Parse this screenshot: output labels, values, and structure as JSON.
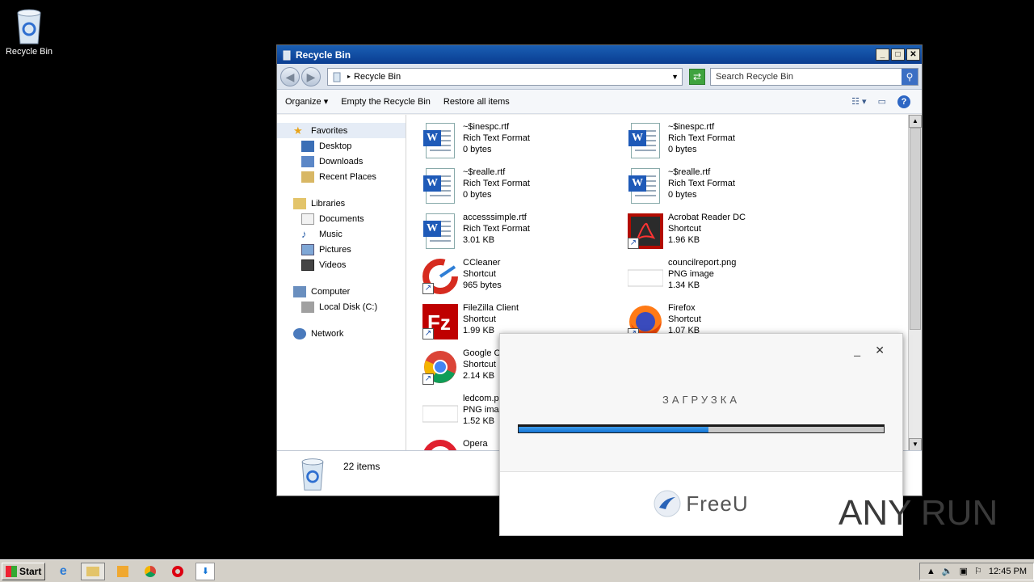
{
  "desktop": {
    "recycle_bin_label": "Recycle Bin"
  },
  "window": {
    "title": "Recycle Bin",
    "controls": {
      "minimize": "_",
      "maximize": "□",
      "close": "✕"
    },
    "address": {
      "breadcrumb": "Recycle Bin"
    },
    "search": {
      "placeholder": "Search Recycle Bin"
    },
    "toolbar": {
      "organize": "Organize",
      "empty": "Empty the Recycle Bin",
      "restore": "Restore all items"
    },
    "nav": {
      "favorites": {
        "label": "Favorites",
        "items": [
          "Desktop",
          "Downloads",
          "Recent Places"
        ]
      },
      "libraries": {
        "label": "Libraries",
        "items": [
          "Documents",
          "Music",
          "Pictures",
          "Videos"
        ]
      },
      "computer": {
        "label": "Computer",
        "items": [
          "Local Disk (C:)"
        ]
      },
      "network": {
        "label": "Network"
      }
    },
    "files": [
      {
        "name": "~$inespc.rtf",
        "type": "Rich Text Format",
        "size": "0 bytes",
        "icon": "word-icon"
      },
      {
        "name": "~$inespc.rtf",
        "type": "Rich Text Format",
        "size": "0 bytes",
        "icon": "word-icon"
      },
      {
        "name": "~$realle.rtf",
        "type": "Rich Text Format",
        "size": "0 bytes",
        "icon": "word-icon"
      },
      {
        "name": "~$realle.rtf",
        "type": "Rich Text Format",
        "size": "0 bytes",
        "icon": "word-icon"
      },
      {
        "name": "accesssimple.rtf",
        "type": "Rich Text Format",
        "size": "3.01 KB",
        "icon": "word-icon"
      },
      {
        "name": "Acrobat Reader DC",
        "type": "Shortcut",
        "size": "1.96 KB",
        "icon": "acrobat-icon"
      },
      {
        "name": "CCleaner",
        "type": "Shortcut",
        "size": "965 bytes",
        "icon": "ccleaner-icon"
      },
      {
        "name": "councilreport.png",
        "type": "PNG image",
        "size": "1.34 KB",
        "icon": "png-icon"
      },
      {
        "name": "FileZilla Client",
        "type": "Shortcut",
        "size": "1.99 KB",
        "icon": "filezilla-icon"
      },
      {
        "name": "Firefox",
        "type": "Shortcut",
        "size": "1.07 KB",
        "icon": "firefox-icon"
      },
      {
        "name": "Google C",
        "type": "Shortcut",
        "size": "2.14 KB",
        "icon": "chrome-icon"
      },
      {
        "name": "ledcom.p",
        "type": "PNG imag",
        "size": "1.52 KB",
        "icon": "png-icon"
      },
      {
        "name": "Opera",
        "type": "",
        "size": "",
        "icon": "opera-icon"
      }
    ],
    "details": {
      "count": "22 items"
    }
  },
  "popup": {
    "title": "ЗАГРУЗКА",
    "minimize": "_",
    "close": "✕",
    "progress": 0.52,
    "brand": "FreeU"
  },
  "watermark": {
    "text": "ANY RUN"
  },
  "taskbar": {
    "start": "Start",
    "clock": "12:45 PM"
  },
  "colors": {
    "title_bar": "#0a3d91",
    "progress_fill": "#1475d6",
    "progress_track": "#c8c8c8"
  }
}
